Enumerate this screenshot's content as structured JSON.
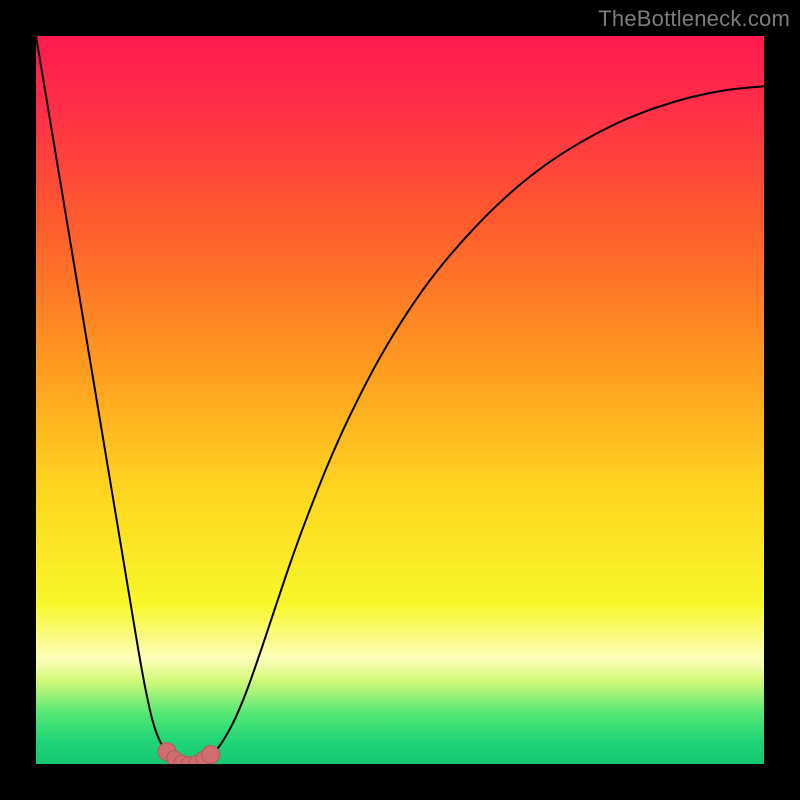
{
  "watermark": "TheBottleneck.com",
  "colors": {
    "frame": "#000000",
    "watermark": "#7c7c7c",
    "curve": "#000000",
    "markers_fill": "#cf6d6f",
    "markers_stroke": "#b55759",
    "gradient_stops": [
      {
        "offset": 0.0,
        "color": "#ff1a50"
      },
      {
        "offset": 0.1,
        "color": "#ff2f47"
      },
      {
        "offset": 0.25,
        "color": "#ff5a2f"
      },
      {
        "offset": 0.45,
        "color": "#ff9a20"
      },
      {
        "offset": 0.62,
        "color": "#ffd420"
      },
      {
        "offset": 0.78,
        "color": "#f7f72a"
      },
      {
        "offset": 0.855,
        "color": "#fdfebb"
      },
      {
        "offset": 0.885,
        "color": "#d4f97a"
      },
      {
        "offset": 0.93,
        "color": "#55e874"
      },
      {
        "offset": 0.97,
        "color": "#1fd477"
      },
      {
        "offset": 1.0,
        "color": "#17c873"
      }
    ]
  },
  "chart_data": {
    "type": "line",
    "title": "",
    "xlabel": "",
    "ylabel": "",
    "xlim": [
      0,
      100
    ],
    "ylim": [
      0,
      100
    ],
    "x": [
      0,
      1,
      2,
      3,
      4,
      5,
      6,
      7,
      8,
      9,
      10,
      11,
      12,
      13,
      14,
      15,
      16,
      17,
      18,
      19,
      20,
      21,
      22,
      23,
      24,
      25,
      26,
      27,
      28,
      29,
      30,
      31,
      32,
      33,
      35,
      37,
      40,
      43,
      47,
      51,
      55,
      60,
      65,
      70,
      75,
      80,
      85,
      90,
      95,
      100
    ],
    "values": [
      100,
      94.0,
      88.0,
      82.0,
      76.0,
      70.0,
      64.0,
      58.0,
      52.0,
      46.0,
      40.0,
      34.0,
      28.0,
      22.0,
      16.0,
      10.5,
      6.0,
      3.2,
      1.7,
      0.8,
      0.2,
      0.0,
      0.1,
      0.5,
      1.2,
      2.2,
      3.7,
      5.5,
      7.7,
      10.2,
      13.0,
      15.9,
      18.9,
      21.9,
      27.8,
      33.3,
      40.9,
      47.6,
      55.4,
      62.0,
      67.6,
      73.4,
      78.3,
      82.3,
      85.5,
      88.1,
      90.1,
      91.6,
      92.6,
      93.1
    ],
    "markers": {
      "x": [
        18,
        19,
        20,
        21,
        22,
        23,
        24
      ],
      "values": [
        1.7,
        0.8,
        0.2,
        0.0,
        0.1,
        0.7,
        1.3
      ]
    }
  }
}
